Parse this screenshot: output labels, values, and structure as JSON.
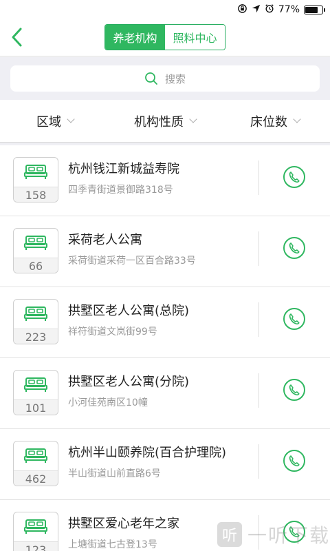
{
  "status_bar": {
    "icons": [
      "rotation-lock-icon",
      "location-arrow-icon",
      "alarm-icon"
    ],
    "battery_text": "77%",
    "battery_level": 0.77
  },
  "nav": {
    "back_icon": "chevron-left-icon",
    "tabs": [
      {
        "label": "养老机构",
        "active": true
      },
      {
        "label": "照料中心",
        "active": false
      }
    ]
  },
  "search": {
    "placeholder": "搜索",
    "icon": "search-icon"
  },
  "filters": [
    {
      "label": "区域"
    },
    {
      "label": "机构性质"
    },
    {
      "label": "床位数"
    }
  ],
  "facilities": [
    {
      "beds": "158",
      "name": "杭州钱江新城益寿院",
      "address": "四季青街道景御路318号"
    },
    {
      "beds": "66",
      "name": "采荷老人公寓",
      "address": "采荷街道采荷一区百合路33号"
    },
    {
      "beds": "223",
      "name": "拱墅区老人公寓(总院)",
      "address": "祥符街道文岚街99号"
    },
    {
      "beds": "101",
      "name": "拱墅区老人公寓(分院)",
      "address": "小河佳苑南区10幢"
    },
    {
      "beds": "462",
      "name": "杭州半山颐养院(百合护理院)",
      "address": "半山街道山前直路6号"
    },
    {
      "beds": "123",
      "name": "拱墅区爱心老年之家",
      "address": "上塘街道七古登13号"
    }
  ],
  "watermark": {
    "badge": "听",
    "text": "一听下载"
  },
  "colors": {
    "accent": "#2fb760",
    "background": "#efeff4",
    "divider": "#d9d9d9"
  }
}
